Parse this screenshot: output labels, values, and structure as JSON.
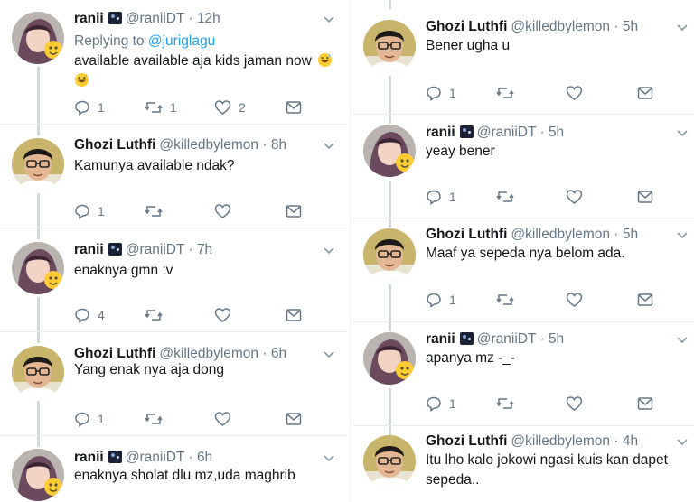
{
  "users": {
    "ranii": {
      "name": "ranii",
      "handle": "@raniiDT"
    },
    "ghozi": {
      "name": "Ghozi Luthfi",
      "handle": "@killedbylemon"
    }
  },
  "separator": "·",
  "left_column": [
    {
      "user": "ranii",
      "time": "12h",
      "reply_label": "Replying to",
      "reply_to": "@juriglagu",
      "text": "available available aja kids jaman now",
      "emoji": "grinning-sweat-emoji",
      "replies": "1",
      "retweets": "1",
      "likes": "2"
    },
    {
      "user": "ghozi",
      "time": "8h",
      "text": "Kamunya available ndak?",
      "replies": "1",
      "retweets": "",
      "likes": ""
    },
    {
      "user": "ranii",
      "time": "7h",
      "text": "enaknya gmn :v",
      "replies": "4",
      "retweets": "",
      "likes": ""
    },
    {
      "user": "ghozi",
      "time": "6h",
      "text": "Yang enak nya aja dong",
      "replies": "1",
      "retweets": "",
      "likes": ""
    },
    {
      "user": "ranii",
      "time": "6h",
      "text": "enaknya sholat dlu mz,uda maghrib",
      "replies": "",
      "retweets": "",
      "likes": ""
    }
  ],
  "right_column": [
    {
      "user": "ghozi",
      "time": "5h",
      "text": "Bener ugha u",
      "replies": "1",
      "retweets": "",
      "likes": ""
    },
    {
      "user": "ranii",
      "time": "5h",
      "text": "yeay bener",
      "replies": "1",
      "retweets": "",
      "likes": ""
    },
    {
      "user": "ghozi",
      "time": "5h",
      "text": "Maaf ya sepeda nya belom ada.",
      "replies": "1",
      "retweets": "",
      "likes": ""
    },
    {
      "user": "ranii",
      "time": "5h",
      "text": "apanya mz -_-",
      "replies": "1",
      "retweets": "",
      "likes": ""
    },
    {
      "user": "ghozi",
      "time": "4h",
      "text_line1": "Itu lho kalo jokowi ngasi kuis kan dapet",
      "text_line2": "sepeda..",
      "replies": "",
      "retweets": "",
      "likes": ""
    }
  ],
  "colors": {
    "name": "#14171a",
    "secondary": "#657786",
    "link": "#1da1f2",
    "thread_line": "#cfd9de",
    "divider": "#e6ecf0"
  }
}
